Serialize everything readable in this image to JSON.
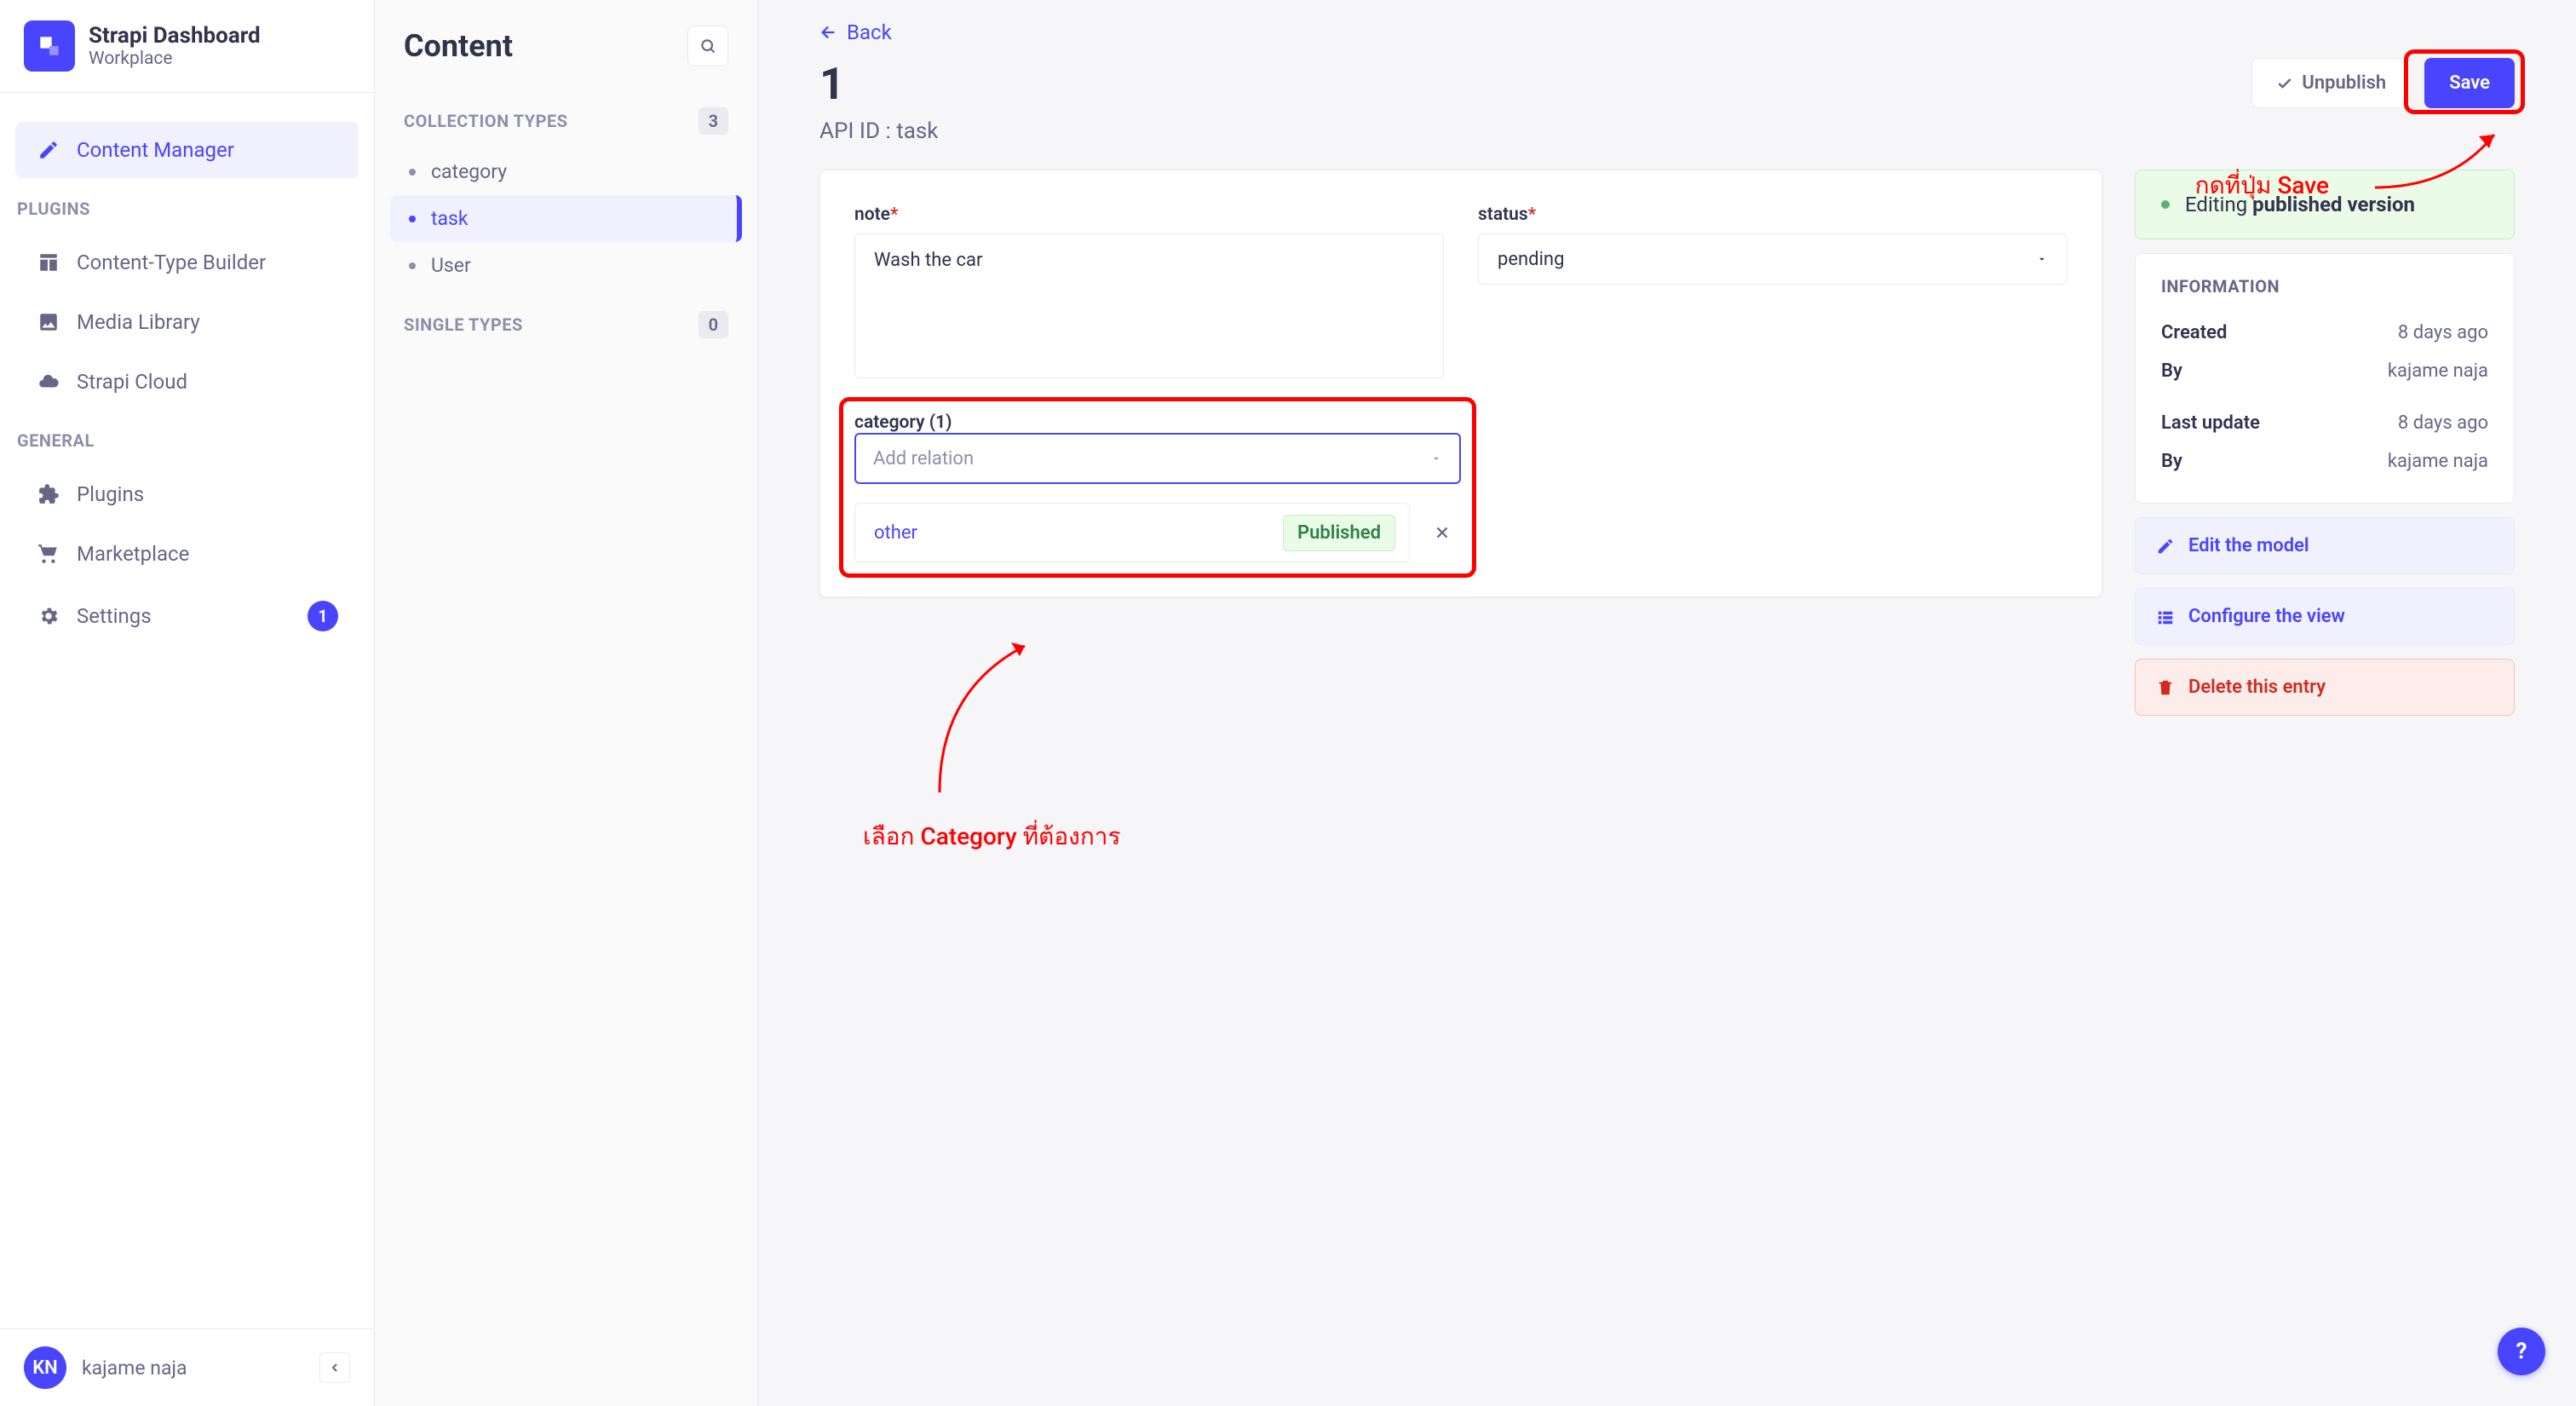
{
  "brand": {
    "title": "Strapi Dashboard",
    "subtitle": "Workplace"
  },
  "nav": {
    "sections": {
      "primary": [
        {
          "label": "Content Manager",
          "icon": "pencil-square-icon",
          "active": true
        }
      ],
      "plugins_header": "PLUGINS",
      "plugins": [
        {
          "label": "Content-Type Builder",
          "icon": "layout-icon"
        },
        {
          "label": "Media Library",
          "icon": "image-icon"
        },
        {
          "label": "Strapi Cloud",
          "icon": "cloud-icon"
        }
      ],
      "general_header": "GENERAL",
      "general": [
        {
          "label": "Plugins",
          "icon": "puzzle-icon"
        },
        {
          "label": "Marketplace",
          "icon": "cart-icon"
        },
        {
          "label": "Settings",
          "icon": "gear-icon",
          "badge": "1"
        }
      ]
    }
  },
  "user": {
    "initials": "KN",
    "name": "kajame naja"
  },
  "content_panel": {
    "title": "Content",
    "collection_types_label": "COLLECTION TYPES",
    "collection_count": "3",
    "collection_items": [
      {
        "label": "category",
        "active": false
      },
      {
        "label": "task",
        "active": true
      },
      {
        "label": "User",
        "active": false
      }
    ],
    "single_types_label": "SINGLE TYPES",
    "single_count": "0"
  },
  "page": {
    "back_label": "Back",
    "title": "1",
    "api_id_label": "API ID : task",
    "unpublish_label": "Unpublish",
    "save_label": "Save"
  },
  "form": {
    "note_label": "note",
    "note_value": "Wash the car",
    "status_label": "status",
    "status_value": "pending",
    "category_label": "category (1)",
    "relation_placeholder": "Add relation",
    "relation_item": "other",
    "relation_status": "Published"
  },
  "status_box": {
    "prefix": "Editing ",
    "bold": "published version"
  },
  "info": {
    "title": "INFORMATION",
    "created_label": "Created",
    "created_value": "8 days ago",
    "created_by_label": "By",
    "created_by_value": "kajame naja",
    "updated_label": "Last update",
    "updated_value": "8 days ago",
    "updated_by_label": "By",
    "updated_by_value": "kajame naja"
  },
  "side_actions": {
    "edit_model": "Edit the model",
    "configure_view": "Configure the view",
    "delete_entry": "Delete this entry"
  },
  "annotations": {
    "save_hint": "กดที่ปุ่ม Save",
    "category_hint": "เลือก Category ที่ต้องการ"
  },
  "fab": "?"
}
